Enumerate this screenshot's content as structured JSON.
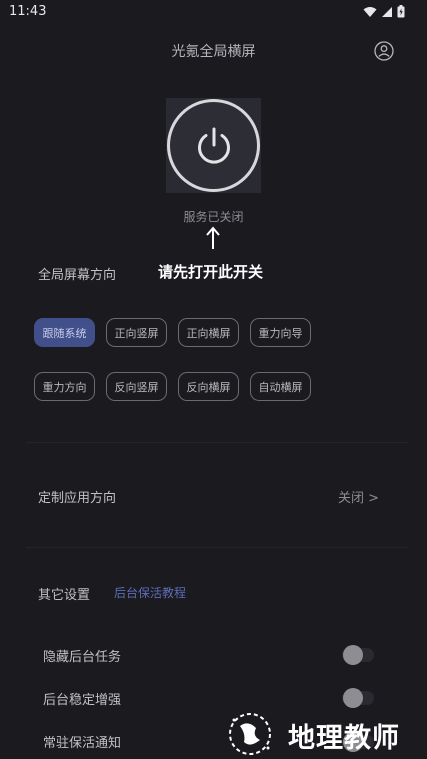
{
  "status_bar": {
    "time": "11:43"
  },
  "header": {
    "title": "光氪全局横屏"
  },
  "power": {
    "status": "服务已关闭"
  },
  "annotation": {
    "text": "请先打开此开关"
  },
  "orientation": {
    "label": "全局屏幕方向",
    "options": [
      "跟随系统",
      "正向竖屏",
      "正向横屏",
      "重力向导",
      "重力方向",
      "反向竖屏",
      "反向横屏",
      "自动横屏"
    ],
    "selected": "跟随系统"
  },
  "app_orientation": {
    "label": "定制应用方向",
    "value": "关闭 >"
  },
  "other_settings": {
    "label": "其它设置",
    "tutorial_link": "后台保活教程",
    "items": [
      {
        "label": "隐藏后台任务",
        "enabled": false
      },
      {
        "label": "后台稳定增强",
        "enabled": false
      },
      {
        "label": "常驻保活通知",
        "enabled": false
      }
    ]
  },
  "watermark": {
    "text": "地理教师"
  },
  "colors": {
    "background": "#1a1a1f",
    "accent": "#41508b",
    "link": "#5d6eb6"
  }
}
